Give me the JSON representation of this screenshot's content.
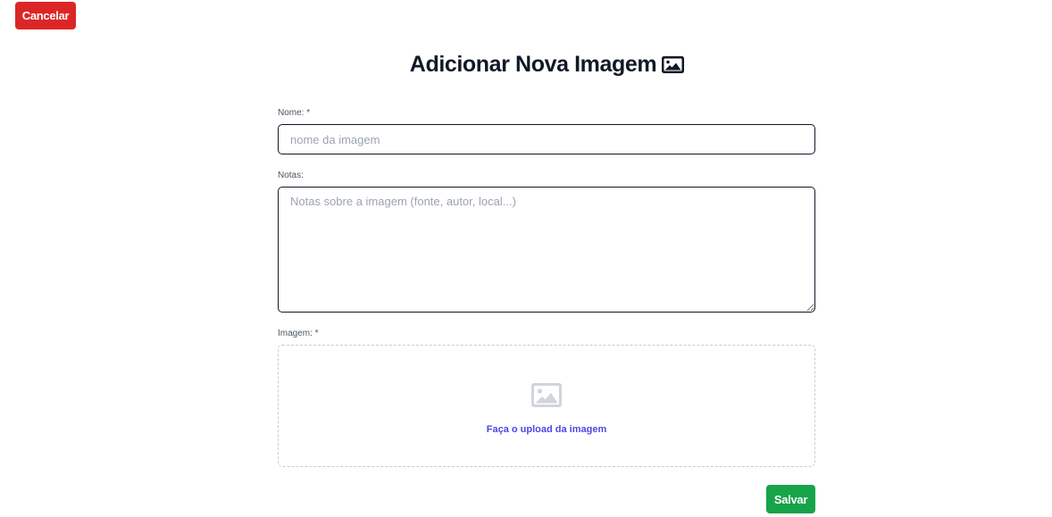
{
  "header": {
    "cancel_label": "Cancelar",
    "title": "Adicionar Nova Imagem",
    "title_icon": "image-icon"
  },
  "form": {
    "nome": {
      "label": "Nome: *",
      "placeholder": "nome da imagem",
      "value": ""
    },
    "notas": {
      "label": "Notas:",
      "placeholder": "Notas sobre a imagem (fonte, autor, local...)",
      "value": ""
    },
    "imagem": {
      "label": "Imagem: *",
      "upload_icon": "image-placeholder-icon",
      "upload_text": "Faça o upload da imagem"
    },
    "save_label": "Salvar"
  },
  "colors": {
    "cancel": "#dc2626",
    "save": "#16a34a",
    "upload_link": "#4f46e5",
    "upload_icon": "#d1d5db"
  }
}
